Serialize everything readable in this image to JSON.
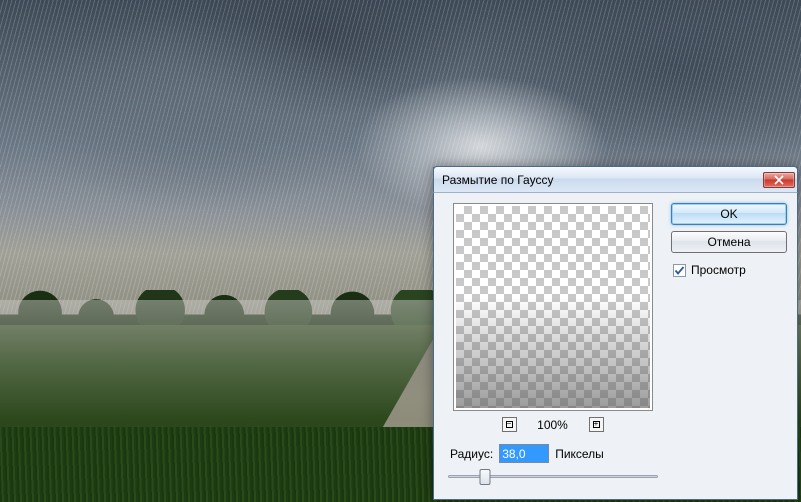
{
  "dialog": {
    "title": "Размытие по Гауссу",
    "ok_label": "OK",
    "cancel_label": "Отмена",
    "preview_label": "Просмотр",
    "preview_checked": true,
    "zoom_value": "100%",
    "radius_label": "Радиус:",
    "radius_value": "38,0",
    "radius_units": "Пикселы",
    "slider_percent": 18
  }
}
